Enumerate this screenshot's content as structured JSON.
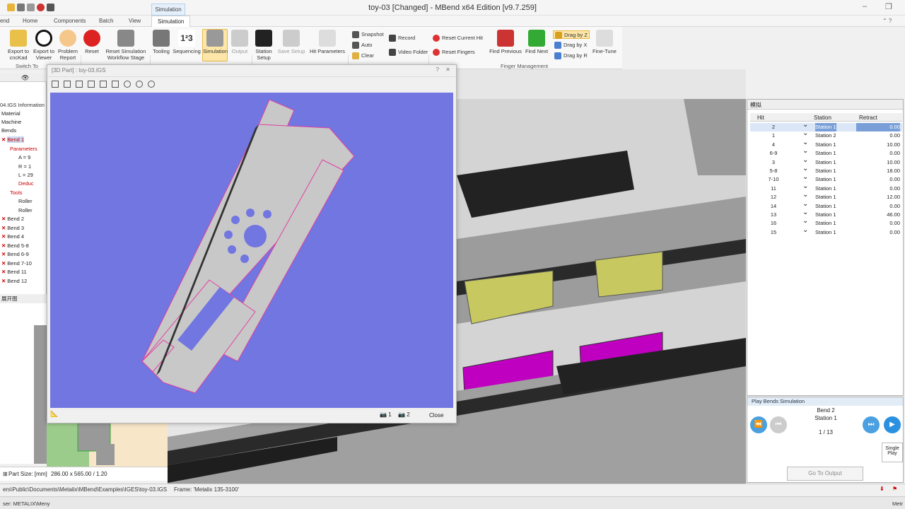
{
  "window": {
    "title": "toy-03 [Changed] - MBend x64 Edition [v9.7.259]"
  },
  "tabs": {
    "context": "Simulation",
    "end": "end",
    "home": "Home",
    "components": "Components",
    "batch": "Batch",
    "view": "View",
    "simulation": "Simulation"
  },
  "ribbon": {
    "export_cnc": "Export to cncKad",
    "export_viewer": "Export to Viewer",
    "problem": "Problem Report",
    "switch_to": "Switch To",
    "reset": "Reset",
    "reset_sim": "Reset Simulation Workflow Stage",
    "tooling": "Tooling",
    "sequencing": "Sequencing",
    "simulation": "Simulation",
    "output": "Output",
    "station_setup": "Station Setup",
    "save_setup": "Save Setup",
    "hit_params": "Hit Parameters",
    "snapshot": "Snapshot",
    "auto": "Auto",
    "clear": "Clear",
    "record": "Record",
    "video_folder": "Video Folder",
    "reset_current_hit": "Reset Current Hit",
    "reset_fingers": "Reset Fingers",
    "find_previous": "Find Previous",
    "find_next": "Find Next",
    "drag_z": "Drag by Z",
    "drag_x": "Drag by X",
    "drag_r": "Drag by R",
    "fine_tune": "Fine-Tune",
    "finger_mgmt": "Finger Management"
  },
  "dialog": {
    "title": "[3D Part] : toy-03.IGS",
    "cam1": "1",
    "cam2": "2",
    "close": "Close"
  },
  "left_tree": {
    "header": "04.IGS Information",
    "items": [
      "Material",
      "Machine",
      "Bends",
      "Bend 1",
      "Parameters",
      "A = 9",
      "R = 1",
      "L = 29",
      "Deduc",
      "Tools",
      "Roller",
      "Roller",
      "Bend 2",
      "Bend 3",
      "Bend 4",
      "Bend 5-8",
      "Bend 6-9",
      "Bend 7-10",
      "Bend 11",
      "Bend 12"
    ],
    "bottom_header": "展开图",
    "part_size_label": "Part Size: [mm]",
    "part_size_value": "286.00 x 565.00 / 1.20"
  },
  "hit_grid": {
    "title": "模拟",
    "columns": [
      "Hit",
      "Station",
      "Retract"
    ],
    "rows": [
      [
        "2",
        "Station 1",
        "0.00"
      ],
      [
        "1",
        "Station 2",
        "0.00"
      ],
      [
        "4",
        "Station 1",
        "10.00"
      ],
      [
        "6-9",
        "Station 1",
        "0.00"
      ],
      [
        "3",
        "Station 1",
        "10.00"
      ],
      [
        "5-8",
        "Station 1",
        "18.00"
      ],
      [
        "7-10",
        "Station 1",
        "0.00"
      ],
      [
        "11",
        "Station 1",
        "0.00"
      ],
      [
        "12",
        "Station 1",
        "12.00"
      ],
      [
        "14",
        "Station 1",
        "0.00"
      ],
      [
        "13",
        "Station 1",
        "46.00"
      ],
      [
        "16",
        "Station 1",
        "0.00"
      ],
      [
        "15",
        "Station 1",
        "0.00"
      ]
    ]
  },
  "play": {
    "header": "Play Bends Simulation",
    "bend": "Bend 2",
    "station": "Station 1",
    "counter": "1 / 13",
    "single": "Single Play",
    "go_output": "Go To Output"
  },
  "status": {
    "path": "ers\\Public\\Documents\\Metalix\\MBend\\Examples\\IGES\\toy-03.IGS",
    "frame": "Frame: 'Metalix 135-3100'",
    "user": "ser: METALIX\\Meny",
    "right": "Metr"
  }
}
